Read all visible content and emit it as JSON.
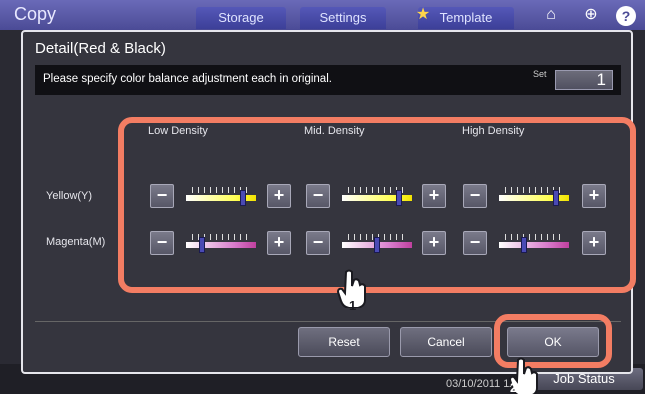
{
  "app": {
    "title": "Copy",
    "tabs": [
      "Storage",
      "Settings",
      "Template"
    ],
    "clock": "03/10/2011 11:",
    "job_status": "Job Status"
  },
  "dialog": {
    "title": "Detail(Red & Black)",
    "instruction": "Please specify color balance adjustment each in original.",
    "set_label": "Set",
    "set_count": "1",
    "columns": [
      "Low Density",
      "Mid. Density",
      "High Density"
    ],
    "rows": [
      {
        "label": "Yellow(Y)",
        "levels": [
          0.85,
          0.85,
          0.85
        ]
      },
      {
        "label": "Magenta(M)",
        "levels": [
          0.2,
          0.5,
          0.35
        ]
      }
    ],
    "minus_symbol": "−",
    "plus_symbol": "+",
    "buttons": {
      "reset": "Reset",
      "cancel": "Cancel",
      "ok": "OK"
    }
  },
  "callouts": {
    "step1": "1",
    "step2": "2"
  },
  "colors": {
    "highlight": "#f37d63",
    "yellow": "#f2e300",
    "magenta": "#c0409f"
  }
}
